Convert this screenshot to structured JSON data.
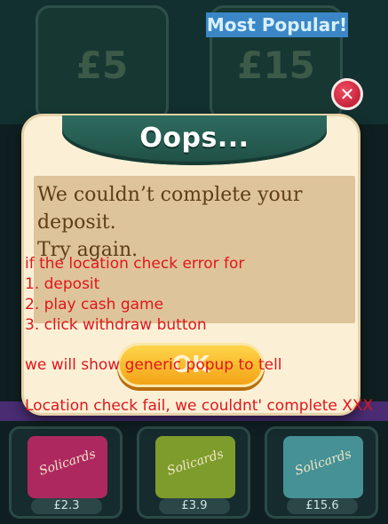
{
  "background": {
    "store_cards": [
      {
        "price": "£5"
      },
      {
        "price": "£15",
        "badge": "Most Popular!"
      }
    ],
    "packs": [
      {
        "name": "Solicards",
        "price": "£2.3",
        "color": "#c9286a"
      },
      {
        "name": "Solicards",
        "price": "£3.9",
        "color": "#8fb02c"
      },
      {
        "name": "Solicards",
        "price": "£15.6",
        "color": "#4da3a8"
      }
    ]
  },
  "dialog": {
    "title": "Oops...",
    "message_line1": "We couldn’t complete your deposit.",
    "message_line2": "Try again.",
    "ok_label": "OK",
    "close_symbol": "✕"
  },
  "annotation": {
    "intro": "if the location check error for",
    "items": [
      "1. deposit",
      "2. play cash game",
      "3. click withdraw button"
    ],
    "line2": "we will show generic popup to tell",
    "line3": "Location check fail, we couldnt' complete XXX"
  },
  "colors": {
    "dialog_bg": "#fbf0d5",
    "header_green": "#2e6b5e",
    "ok_yellow": "#ffd54a",
    "close_red": "#d1203c",
    "annotation_red": "#e0161c"
  }
}
